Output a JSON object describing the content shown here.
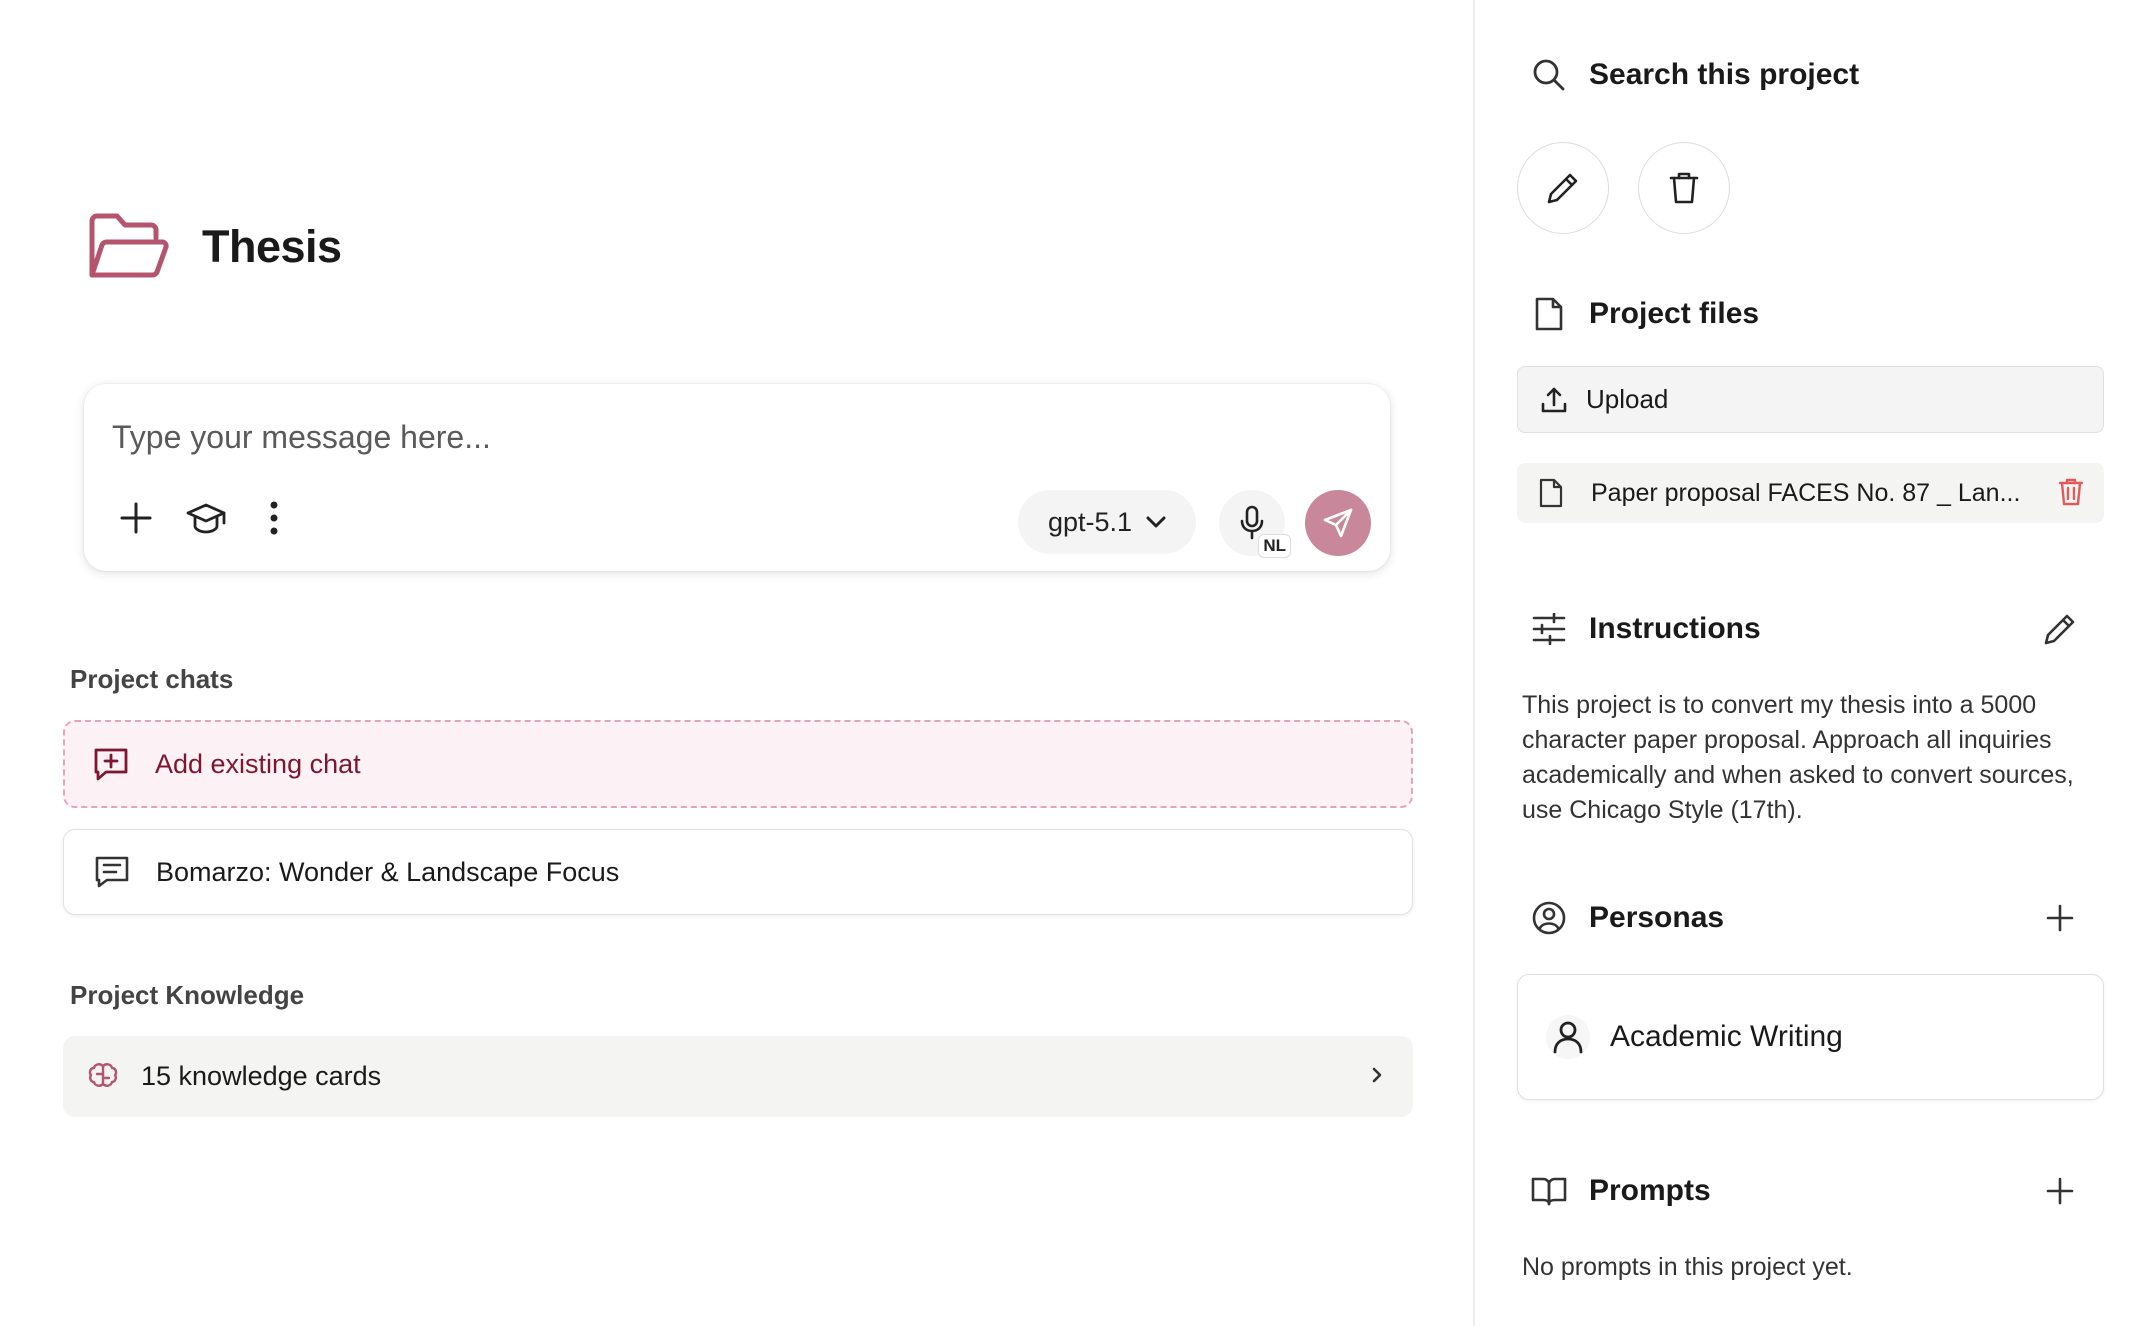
{
  "project": {
    "title": "Thesis"
  },
  "composer": {
    "placeholder": "Type your message here...",
    "model": "gpt-5.1",
    "mic_badge": "NL"
  },
  "chats": {
    "section_label": "Project chats",
    "add_label": "Add existing chat",
    "items": [
      {
        "title": "Bomarzo: Wonder & Landscape Focus"
      }
    ]
  },
  "knowledge": {
    "section_label": "Project Knowledge",
    "cards_label": "15 knowledge cards"
  },
  "panel": {
    "search_label": "Search this project",
    "files": {
      "heading": "Project files",
      "upload_label": "Upload",
      "items": [
        {
          "name": "Paper proposal FACES No. 87 _ Lan..."
        }
      ]
    },
    "instructions": {
      "heading": "Instructions",
      "text": "This project is to convert my thesis into a 5000 character paper proposal. Approach all inquiries academically and when asked to convert sources, use Chicago Style (17th)."
    },
    "personas": {
      "heading": "Personas",
      "items": [
        {
          "name": "Academic Writing"
        }
      ]
    },
    "prompts": {
      "heading": "Prompts",
      "empty_text": "No prompts in this project yet."
    }
  },
  "colors": {
    "accent": "#c8879a",
    "accent_text": "#7d1632",
    "folder_icon": "#b5546f",
    "danger": "#e05a5a"
  },
  "icons": [
    "folder-icon",
    "plus-icon",
    "graduation-cap-icon",
    "more-vertical-icon",
    "chevron-down-icon",
    "microphone-icon",
    "send-icon",
    "message-plus-icon",
    "message-icon",
    "brain-icon",
    "chevron-right-icon",
    "search-icon",
    "pencil-icon",
    "trash-icon",
    "file-icon",
    "upload-icon",
    "sliders-icon",
    "user-circle-icon",
    "user-icon",
    "book-open-icon"
  ]
}
